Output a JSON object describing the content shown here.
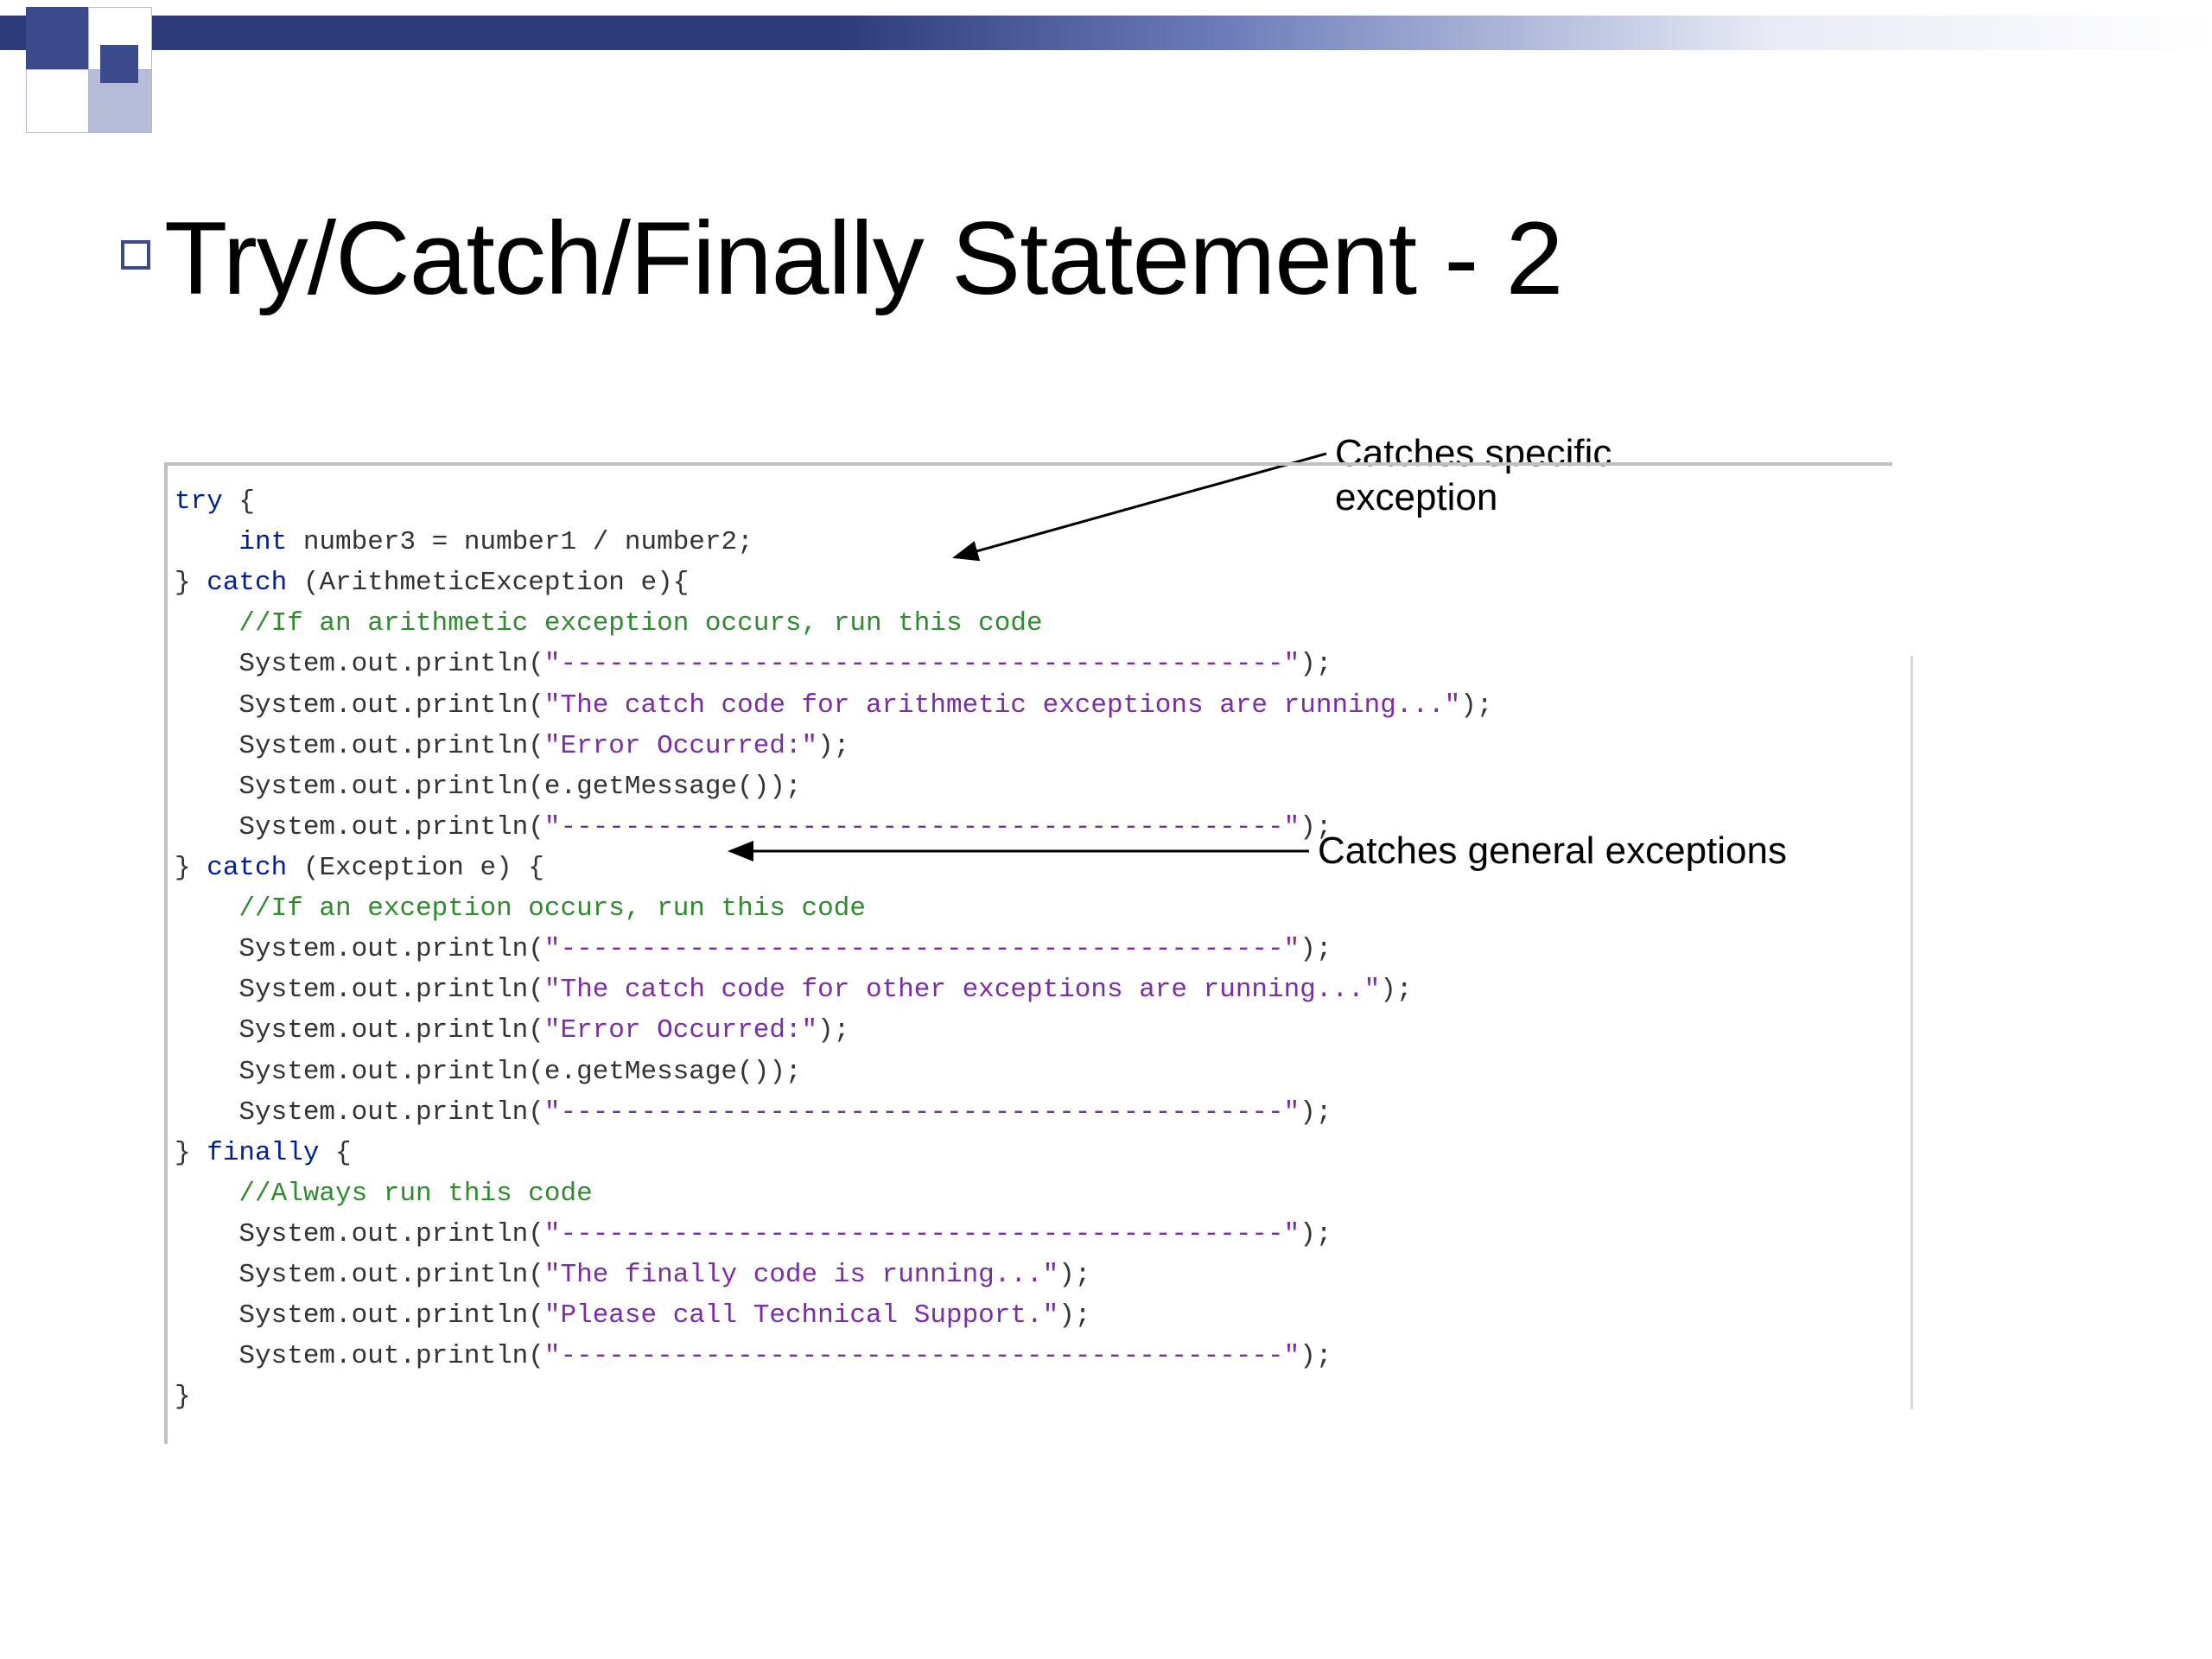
{
  "title": "Try/Catch/Finally Statement - 2",
  "annotations": {
    "specific": "Catches specific exception",
    "general": "Catches general exceptions"
  },
  "code": {
    "l01_kw": "try",
    "l01_rest": " {",
    "l02_type": "int",
    "l02_rest": " number3 = number1 / number2;",
    "l03_a": "} ",
    "l03_kw": "catch",
    "l03_b": " (ArithmeticException e){",
    "l04_cmt": "//If an arithmetic exception occurs, run this code",
    "l05_a": "System.out.println(",
    "l05_s": "\"---------------------------------------------\"",
    "l05_b": ");",
    "l06_a": "System.out.println(",
    "l06_s": "\"The catch code for arithmetic exceptions are running...\"",
    "l06_b": ");",
    "l07_a": "System.out.println(",
    "l07_s": "\"Error Occurred:\"",
    "l07_b": ");",
    "l08": "System.out.println(e.getMessage());",
    "l09_a": "System.out.println(",
    "l09_s": "\"---------------------------------------------\"",
    "l09_b": ");",
    "l10_a": "} ",
    "l10_kw": "catch",
    "l10_b": " (Exception e) {",
    "l11_cmt": "//If an exception occurs, run this code",
    "l12_a": "System.out.println(",
    "l12_s": "\"---------------------------------------------\"",
    "l12_b": ");",
    "l13_a": "System.out.println(",
    "l13_s": "\"The catch code for other exceptions are running...\"",
    "l13_b": ");",
    "l14_a": "System.out.println(",
    "l14_s": "\"Error Occurred:\"",
    "l14_b": ");",
    "l15": "System.out.println(e.getMessage());",
    "l16_a": "System.out.println(",
    "l16_s": "\"---------------------------------------------\"",
    "l16_b": ");",
    "l17_a": "} ",
    "l17_kw": "finally",
    "l17_b": " {",
    "l18_cmt": "//Always run this code",
    "l19_a": "System.out.println(",
    "l19_s": "\"---------------------------------------------\"",
    "l19_b": ");",
    "l20_a": "System.out.println(",
    "l20_s": "\"The finally code is running...\"",
    "l20_b": ");",
    "l21_a": "System.out.println(",
    "l21_s": "\"Please call Technical Support.\"",
    "l21_b": ");",
    "l22_a": "System.out.println(",
    "l22_s": "\"---------------------------------------------\"",
    "l22_b": ");",
    "l23": "}"
  }
}
